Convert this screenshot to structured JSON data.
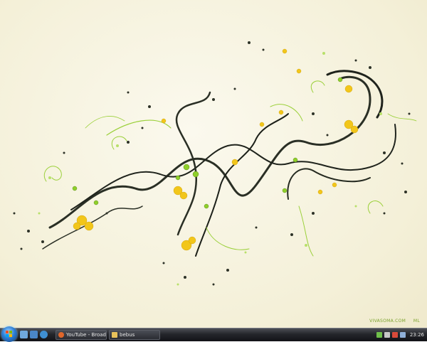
{
  "desktop": {
    "watermark": "VIVASOMA.COM    ML"
  },
  "taskbar": {
    "start_icon": "windows-orb-icon",
    "quick_launch": [
      {
        "name": "show-desktop-icon",
        "color": "#6fa8dc"
      },
      {
        "name": "switch-windows-icon",
        "color": "#4a86c8"
      },
      {
        "name": "internet-explorer-icon",
        "color": "#3f8fd2"
      }
    ],
    "tasks": [
      {
        "label": "YouTube - Broadcas...",
        "icon": "firefox-icon",
        "icon_color": "#e0662a"
      },
      {
        "label": "bebus",
        "icon": "folder-icon",
        "icon_color": "#e8c25a"
      }
    ],
    "tray_icons": [
      {
        "name": "network-icon",
        "color": "#6fbf4a"
      },
      {
        "name": "volume-icon",
        "color": "#c7c7c7"
      },
      {
        "name": "security-icon",
        "color": "#d94a3a"
      },
      {
        "name": "app-tray-icon",
        "color": "#8fb0d8"
      }
    ],
    "clock": "23:26"
  }
}
